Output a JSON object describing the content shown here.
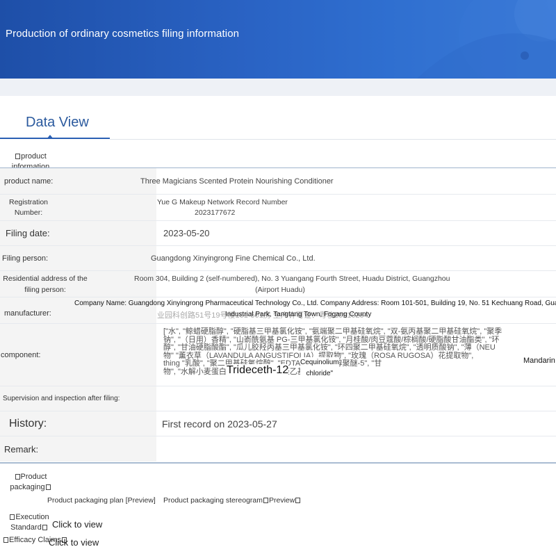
{
  "header": {
    "title": "Production of ordinary cosmetics filing information"
  },
  "tabs": {
    "active_label": "Data View"
  },
  "sections": {
    "product_information": [
      "product",
      "information"
    ],
    "product_packaging": [
      "Product",
      "packaging"
    ],
    "execution_standard": [
      "Execution",
      "Standard"
    ],
    "efficacy_claims": "Efficacy Claims"
  },
  "fields": {
    "product_name": {
      "label": "product name:",
      "value": "Three Magicians Scented Protein Nourishing Conditioner"
    },
    "registration_number": {
      "label": [
        "Registration",
        "Number:"
      ],
      "value": [
        "Yue G Makeup Network Record Number",
        "2023177672"
      ]
    },
    "filing_date": {
      "label": "Filing date:",
      "value": "2023-05-20"
    },
    "filing_person": {
      "label": "Filing person:",
      "value": "Guangdong Xinyingrong Fine Chemical Co., Ltd."
    },
    "filing_address": {
      "label": [
        "Residential address of the",
        "filing person:"
      ],
      "value": [
        "Room 304, Building 2 (self-numbered), No. 3 Yuangang Fourth Street, Huadu District, Guangzhou",
        "(Airport Huadu)"
      ]
    },
    "manufacturer": {
      "label": "manufacturer:",
      "value": [
        "Company Name: Guangdong Xinyingrong Pharmaceutical Technology Co., Ltd. Company Address: Room 101-501, Building 19, No. 51 Kechuang Road, Guangfo",
        "Industrial Park, Tangtang Town, Fogang County"
      ],
      "underlay": "业园科创路51号19号楼101-501房 生产许可证：粤妆20210254"
    },
    "component": {
      "label": "component:",
      "lines": [
        "[\"水\", \"鲸蜡硬脂醇\", \"硬脂基三甲基氯化铵\", \"氨端聚二甲基硅氧烷\", \"双-氨丙基聚二甲基硅氧烷\", \"聚季",
        "钠\", \"（日用）香精\", \"山嵛酰氨基 PG-三甲基氯化铵\", \"月桂酸/肉豆蔻酸/棕榈酸/硬脂酸甘油酯类\", \"环",
        "醇\", \"甘油硬脂酸酯\", \"瓜儿胶羟丙基三甲基氯化铵\", \"环四聚二甲基硅氧烷\", \"透明质酸钠\", \"薄（NEU",
        "物\" \"薰衣草（LAVANDULA ANGUSTIFOLIA）提取物\", \"玫瑰（ROSA RUGOSA）花提取物\",",
        "thing \"乳酸\", \"聚二甲基硅氧烷醇\", \"EDTA 二钠\", \"油醇聚醚-5\", \"甘",
        "物\", \"水解小麦蛋白\", \"1,2-己二醇\", \"羟乙基纤维素\"]"
      ],
      "overlay_words": {
        "trideceth": "Trideceth-12",
        "cequinolium": [
          "Cequinolium",
          "chloride\""
        ],
        "mandarin": "Mandarin"
      }
    },
    "supervision": {
      "label": "Supervision and inspection after filing:",
      "value": ""
    },
    "history": {
      "label": "History:",
      "value": "First record on 2023-05-27"
    },
    "remark": {
      "label": "Remark:",
      "value": ""
    }
  },
  "packaging": {
    "plan_label": "Product packaging plan [Preview]",
    "stereogram_label_prefix": "Product packaging stereogram",
    "stereogram_label_suffix": "Preview"
  },
  "links": {
    "execution_view": "Click to view",
    "efficacy_view": "Click to view"
  }
}
